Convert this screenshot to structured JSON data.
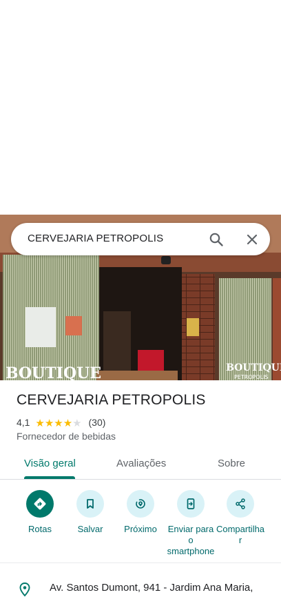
{
  "search": {
    "query": "CERVEJARIA PETROPOLIS",
    "search_icon": "search-icon",
    "clear_icon": "close-icon"
  },
  "photo": {
    "sign_left": "BOUTIQUE",
    "sign_right": "BOUTIQUE",
    "sign_right_sub": "PETROPOLIS"
  },
  "place": {
    "name": "CERVEJARIA PETROPOLIS",
    "rating": "4,1",
    "rating_value": 4.1,
    "stars_filled": 4,
    "stars_total": 5,
    "review_count": "(30)",
    "category": "Fornecedor de bebidas"
  },
  "tabs": [
    {
      "label": "Visão geral",
      "active": true
    },
    {
      "label": "Avaliações",
      "active": false
    },
    {
      "label": "Sobre",
      "active": false
    }
  ],
  "actions": [
    {
      "label": "Rotas",
      "icon": "directions-icon"
    },
    {
      "label": "Salvar",
      "icon": "bookmark-icon"
    },
    {
      "label": "Próximo",
      "icon": "nearby-icon"
    },
    {
      "label_lines": [
        "Enviar para",
        "o",
        "smartphone"
      ],
      "icon": "send-to-phone-icon"
    },
    {
      "label_lines": [
        "Compartilha",
        "r"
      ],
      "icon": "share-icon"
    }
  ],
  "address": {
    "text": "Av. Santos Dumont, 941 - Jardim Ana Maria,",
    "icon": "location-pin-icon"
  },
  "colors": {
    "accent": "#00796b",
    "action_bg": "#d9f2f7",
    "star": "#fbbc04"
  }
}
